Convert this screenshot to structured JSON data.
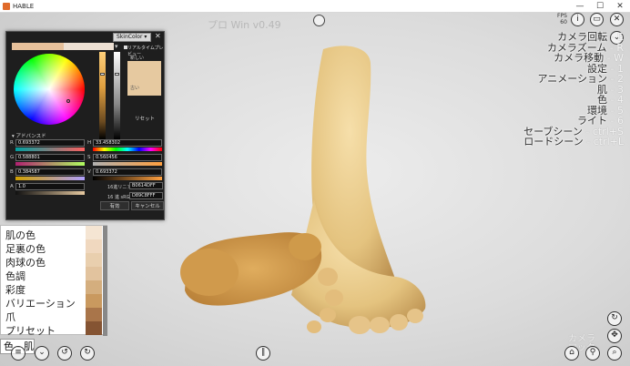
{
  "titlebar": {
    "title": "HABLE",
    "minimize": "—",
    "maximize": "☐",
    "close": "✕"
  },
  "watermark": "プロ Win v0.49",
  "fps": {
    "label": "FPS",
    "value": "60"
  },
  "menu": [
    {
      "label": "カメラ回転",
      "key": " - E"
    },
    {
      "label": "カメラズーム",
      "key": " - R"
    },
    {
      "label": "カメラ移動",
      "key": " - W"
    },
    {
      "label": "設定",
      "key": " - 1"
    },
    {
      "label": "アニメーション",
      "key": " - 2"
    },
    {
      "label": "肌",
      "key": " - 3"
    },
    {
      "label": "色",
      "key": " - 4"
    },
    {
      "label": "環境",
      "key": " - 5"
    },
    {
      "label": "ライト",
      "key": " - 6"
    },
    {
      "label": "セーブシーン",
      "key": " - ctrl+S"
    },
    {
      "label": "ロードシーン",
      "key": " - ctrl+L"
    }
  ],
  "dialog": {
    "preset": "SkinColor",
    "dropdown_arrow": "▾",
    "close": "✕",
    "realtime_preview": "リアルタイムプレビュー",
    "new_label": "新しい",
    "old_label": "古い",
    "reset": "リセット",
    "advanced": "▾ アドバンスド",
    "r_label": "R",
    "g_label": "G",
    "b_label": "B",
    "a_label": "A",
    "r_value": "0.693372",
    "g_value": "0.588801",
    "b_value": "0.384587",
    "a_value": "1.0",
    "h_label": "H",
    "s_label": "S",
    "v_label": "V",
    "h_value": "33.458302",
    "s_value": "0.560456",
    "v_value": "0.693372",
    "hex_linear_label": "16進リニア",
    "hex_linear_value": "B0614DFF",
    "hex_srgb_label": "16 進 sRGB",
    "hex_srgb_value": "D89C8FFF",
    "ok": "有効",
    "cancel": "キャンセル"
  },
  "skin_list": {
    "items": [
      "肌の色",
      "足裏の色",
      "肉球の色",
      "色調",
      "彩度",
      "バリエーション",
      "爪",
      "プリセット"
    ],
    "swatch_colors": [
      "#f5e5d3",
      "#f0d8bf",
      "#e9cfae",
      "#e2c39e",
      "#d4ae7e",
      "#c9995f",
      "#a9754a",
      "#855433"
    ]
  },
  "tab": "色 - 肌",
  "camera_lock": [
    "カメラ",
    "ロック"
  ],
  "colors": {
    "dialog_bg": "#1e1e1e",
    "accent": "#e6c9a0"
  },
  "icons": {
    "top_center": "snapshot-icon",
    "info": "i",
    "window": "▭",
    "close": "✕",
    "down": "⌄",
    "menu": "≡",
    "chevron": "⌄",
    "undo": "↺",
    "redo": "↻",
    "pause": "∥",
    "reload": "↻",
    "move": "✥",
    "lock": "⌂",
    "bulb": "⚲",
    "zoom": "⌕"
  }
}
